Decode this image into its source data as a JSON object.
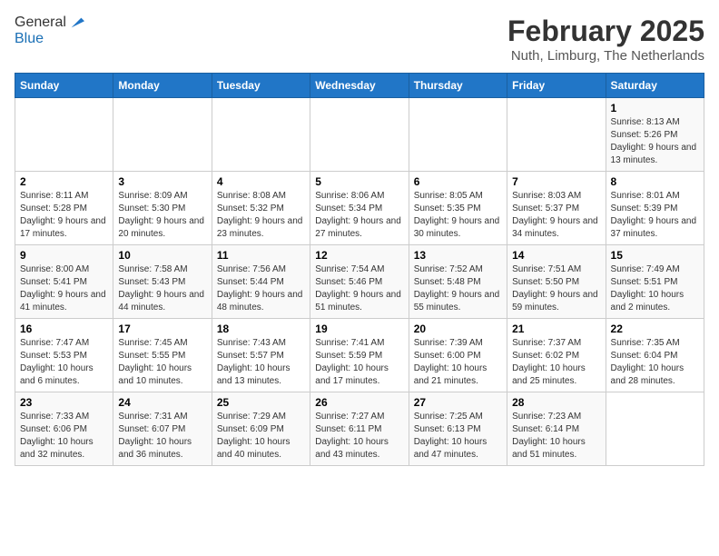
{
  "header": {
    "logo_line1": "General",
    "logo_line2": "Blue",
    "month_title": "February 2025",
    "location": "Nuth, Limburg, The Netherlands"
  },
  "days_of_week": [
    "Sunday",
    "Monday",
    "Tuesday",
    "Wednesday",
    "Thursday",
    "Friday",
    "Saturday"
  ],
  "weeks": [
    [
      {
        "day": "",
        "info": ""
      },
      {
        "day": "",
        "info": ""
      },
      {
        "day": "",
        "info": ""
      },
      {
        "day": "",
        "info": ""
      },
      {
        "day": "",
        "info": ""
      },
      {
        "day": "",
        "info": ""
      },
      {
        "day": "1",
        "info": "Sunrise: 8:13 AM\nSunset: 5:26 PM\nDaylight: 9 hours and 13 minutes."
      }
    ],
    [
      {
        "day": "2",
        "info": "Sunrise: 8:11 AM\nSunset: 5:28 PM\nDaylight: 9 hours and 17 minutes."
      },
      {
        "day": "3",
        "info": "Sunrise: 8:09 AM\nSunset: 5:30 PM\nDaylight: 9 hours and 20 minutes."
      },
      {
        "day": "4",
        "info": "Sunrise: 8:08 AM\nSunset: 5:32 PM\nDaylight: 9 hours and 23 minutes."
      },
      {
        "day": "5",
        "info": "Sunrise: 8:06 AM\nSunset: 5:34 PM\nDaylight: 9 hours and 27 minutes."
      },
      {
        "day": "6",
        "info": "Sunrise: 8:05 AM\nSunset: 5:35 PM\nDaylight: 9 hours and 30 minutes."
      },
      {
        "day": "7",
        "info": "Sunrise: 8:03 AM\nSunset: 5:37 PM\nDaylight: 9 hours and 34 minutes."
      },
      {
        "day": "8",
        "info": "Sunrise: 8:01 AM\nSunset: 5:39 PM\nDaylight: 9 hours and 37 minutes."
      }
    ],
    [
      {
        "day": "9",
        "info": "Sunrise: 8:00 AM\nSunset: 5:41 PM\nDaylight: 9 hours and 41 minutes."
      },
      {
        "day": "10",
        "info": "Sunrise: 7:58 AM\nSunset: 5:43 PM\nDaylight: 9 hours and 44 minutes."
      },
      {
        "day": "11",
        "info": "Sunrise: 7:56 AM\nSunset: 5:44 PM\nDaylight: 9 hours and 48 minutes."
      },
      {
        "day": "12",
        "info": "Sunrise: 7:54 AM\nSunset: 5:46 PM\nDaylight: 9 hours and 51 minutes."
      },
      {
        "day": "13",
        "info": "Sunrise: 7:52 AM\nSunset: 5:48 PM\nDaylight: 9 hours and 55 minutes."
      },
      {
        "day": "14",
        "info": "Sunrise: 7:51 AM\nSunset: 5:50 PM\nDaylight: 9 hours and 59 minutes."
      },
      {
        "day": "15",
        "info": "Sunrise: 7:49 AM\nSunset: 5:51 PM\nDaylight: 10 hours and 2 minutes."
      }
    ],
    [
      {
        "day": "16",
        "info": "Sunrise: 7:47 AM\nSunset: 5:53 PM\nDaylight: 10 hours and 6 minutes."
      },
      {
        "day": "17",
        "info": "Sunrise: 7:45 AM\nSunset: 5:55 PM\nDaylight: 10 hours and 10 minutes."
      },
      {
        "day": "18",
        "info": "Sunrise: 7:43 AM\nSunset: 5:57 PM\nDaylight: 10 hours and 13 minutes."
      },
      {
        "day": "19",
        "info": "Sunrise: 7:41 AM\nSunset: 5:59 PM\nDaylight: 10 hours and 17 minutes."
      },
      {
        "day": "20",
        "info": "Sunrise: 7:39 AM\nSunset: 6:00 PM\nDaylight: 10 hours and 21 minutes."
      },
      {
        "day": "21",
        "info": "Sunrise: 7:37 AM\nSunset: 6:02 PM\nDaylight: 10 hours and 25 minutes."
      },
      {
        "day": "22",
        "info": "Sunrise: 7:35 AM\nSunset: 6:04 PM\nDaylight: 10 hours and 28 minutes."
      }
    ],
    [
      {
        "day": "23",
        "info": "Sunrise: 7:33 AM\nSunset: 6:06 PM\nDaylight: 10 hours and 32 minutes."
      },
      {
        "day": "24",
        "info": "Sunrise: 7:31 AM\nSunset: 6:07 PM\nDaylight: 10 hours and 36 minutes."
      },
      {
        "day": "25",
        "info": "Sunrise: 7:29 AM\nSunset: 6:09 PM\nDaylight: 10 hours and 40 minutes."
      },
      {
        "day": "26",
        "info": "Sunrise: 7:27 AM\nSunset: 6:11 PM\nDaylight: 10 hours and 43 minutes."
      },
      {
        "day": "27",
        "info": "Sunrise: 7:25 AM\nSunset: 6:13 PM\nDaylight: 10 hours and 47 minutes."
      },
      {
        "day": "28",
        "info": "Sunrise: 7:23 AM\nSunset: 6:14 PM\nDaylight: 10 hours and 51 minutes."
      },
      {
        "day": "",
        "info": ""
      }
    ]
  ]
}
